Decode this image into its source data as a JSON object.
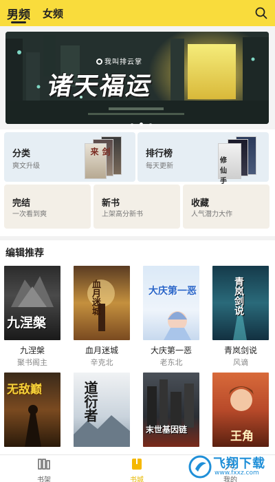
{
  "header": {
    "tabs": [
      {
        "label": "男频",
        "active": true
      },
      {
        "label": "女频",
        "active": false
      }
    ],
    "search_icon": "search-icon",
    "background_color": "#f9dc3c"
  },
  "banner": {
    "subtitle": "我叫排云掌",
    "title": "诸天福运",
    "slides": 3,
    "active_slide": 1
  },
  "categories": [
    {
      "title": "分类",
      "subtitle": "爽文升级"
    },
    {
      "title": "排行榜",
      "subtitle": "每天更新"
    },
    {
      "title": "完结",
      "subtitle": "一次看到爽"
    },
    {
      "title": "新书",
      "subtitle": "上架高分新书"
    },
    {
      "title": "收藏",
      "subtitle": "人气潜力大作"
    }
  ],
  "section": {
    "title": "编辑推荐"
  },
  "books": [
    {
      "name": "九涅槃",
      "author": "聚书阁主",
      "cover_text": "九涅槃"
    },
    {
      "name": "血月迷城",
      "author": "辛克北",
      "cover_text": "血月迷城"
    },
    {
      "name": "大庆第一恶",
      "author": "老东北",
      "cover_text": "大庆第一恶"
    },
    {
      "name": "青岚剑说",
      "author": "风谪",
      "cover_text": "青岚剑说"
    },
    {
      "name": "",
      "author": "",
      "cover_text": "无敌巅"
    },
    {
      "name": "",
      "author": "",
      "cover_text": "道衍者"
    },
    {
      "name": "",
      "author": "",
      "cover_text": "末世基因链"
    },
    {
      "name": "",
      "author": "",
      "cover_text": "王角"
    }
  ],
  "bottom_nav": [
    {
      "label": "书架",
      "icon": "bookshelf-icon",
      "active": false
    },
    {
      "label": "书城",
      "icon": "bookstore-icon",
      "active": true
    },
    {
      "label": "我的",
      "icon": "user-icon",
      "active": false
    }
  ],
  "watermark": {
    "text": "飞翔下载",
    "url": "www.fxxz.com"
  },
  "colors": {
    "accent": "#f9dc3c",
    "active_nav": "#e6b800",
    "card_blue": "#e6eef4",
    "card_beige": "#f3efe7"
  }
}
